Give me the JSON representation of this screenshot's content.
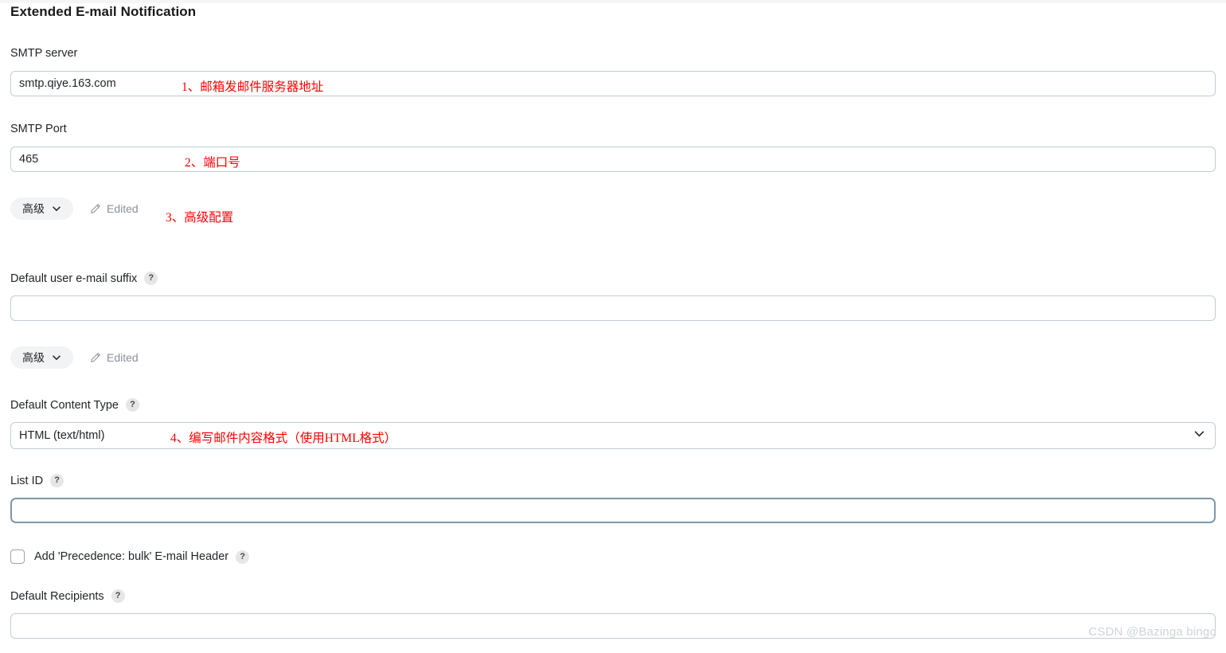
{
  "page": {
    "title": "Extended E-mail Notification",
    "watermark": "CSDN @Bazinga bingo"
  },
  "fields": {
    "smtp_server": {
      "label": "SMTP server",
      "value": "smtp.qiye.163.com",
      "placeholder": ""
    },
    "smtp_port": {
      "label": "SMTP Port",
      "value": "465",
      "placeholder": ""
    },
    "default_user_email_suffix": {
      "label": "Default user e-mail suffix",
      "help": "?",
      "value": "",
      "placeholder": ""
    },
    "default_content_type": {
      "label": "Default Content Type",
      "help": "?",
      "value": "HTML (text/html)",
      "options": [
        "HTML (text/html)"
      ]
    },
    "list_id": {
      "label": "List ID",
      "help": "?",
      "value": "",
      "placeholder": ""
    },
    "precedence_bulk": {
      "label": "Add 'Precedence: bulk' E-mail Header",
      "help": "?",
      "checked": false
    },
    "default_recipients": {
      "label": "Default Recipients",
      "help": "?",
      "value": "",
      "placeholder": ""
    }
  },
  "advanced_rows": [
    {
      "button_label": "高级",
      "edited_label": "Edited"
    },
    {
      "button_label": "高级",
      "edited_label": "Edited"
    }
  ],
  "annotations": [
    {
      "text": "1、邮箱发邮件服务器地址"
    },
    {
      "text": "2、端口号"
    },
    {
      "text": "3、高级配置"
    },
    {
      "text": "4、编写邮件内容格式（使用HTML格式）"
    }
  ],
  "colors": {
    "annotation": "#ff0000",
    "input_border": "#bfcdd4",
    "input_border_focus": "#7d97a8",
    "chip_background": "#f2f3f4",
    "muted_text": "#8a8f9c"
  }
}
